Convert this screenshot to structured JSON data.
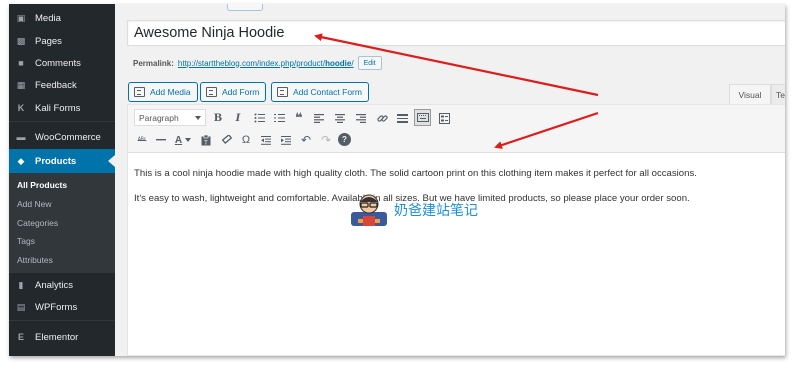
{
  "sidebar": {
    "items": [
      {
        "label": "Media",
        "icon": "media-icon"
      },
      {
        "label": "Pages",
        "icon": "pages-icon"
      },
      {
        "label": "Comments",
        "icon": "comments-icon"
      },
      {
        "label": "Feedback",
        "icon": "feedback-icon"
      },
      {
        "label": "Kali Forms",
        "icon": "kali-forms-icon"
      },
      {
        "label": "WooCommerce",
        "icon": "woocommerce-icon"
      },
      {
        "label": "Products",
        "icon": "products-icon",
        "active": true
      },
      {
        "label": "Analytics",
        "icon": "analytics-icon"
      },
      {
        "label": "WPForms",
        "icon": "wpforms-icon"
      },
      {
        "label": "Elementor",
        "icon": "elementor-icon"
      }
    ],
    "submenu": [
      "All Products",
      "Add New",
      "Categories",
      "Tags",
      "Attributes"
    ]
  },
  "post": {
    "title": "Awesome Ninja Hoodie",
    "permalink_label": "Permalink:",
    "permalink_url_prefix": "http://starttheblog.com/index.php/product/",
    "permalink_slug": "hoodie",
    "permalink_trailing": "/",
    "edit_label": "Edit"
  },
  "media_buttons": [
    "Add Media",
    "Add Form",
    "Add Contact Form"
  ],
  "editor_tabs": {
    "visual": "Visual",
    "text": "Te"
  },
  "toolbar": {
    "format": "Paragraph",
    "row1_icons": [
      "bold-icon",
      "italic-icon",
      "bulleted-list-icon",
      "numbered-list-icon",
      "blockquote-icon",
      "align-left-icon",
      "align-center-icon",
      "align-right-icon",
      "link-icon",
      "read-more-icon",
      "toolbar-toggle-icon",
      "form-icon"
    ],
    "row2_icons": [
      "strikethrough-icon",
      "horizontal-line-icon",
      "text-color-icon",
      "paste-as-text-icon",
      "clear-formatting-icon",
      "special-character-icon",
      "decrease-indent-icon",
      "increase-indent-icon",
      "undo-icon",
      "redo-icon",
      "help-icon"
    ],
    "glyphs": {
      "bold": "B",
      "italic": "I",
      "blockquote": "❝",
      "text_color": "A",
      "special_char": "Ω",
      "help": "?",
      "strike": "ᴬᴮᶜ",
      "undo": "↶",
      "redo": "↷",
      "expand": "⤡"
    }
  },
  "content": {
    "p1": "This is a cool ninja hoodie made with high quality cloth. The solid cartoon print on this clothing item makes it perfect for all occasions.",
    "p2": "It's easy to wash, lightweight and comfortable. Available in all sizes. But we have limited products, so please place your order soon."
  },
  "watermark": {
    "text": "奶爸建站笔记",
    "icon": "ninja-avatar-icon"
  },
  "annotation_color": "#dd1c1c",
  "accent_color": "#0073aa"
}
